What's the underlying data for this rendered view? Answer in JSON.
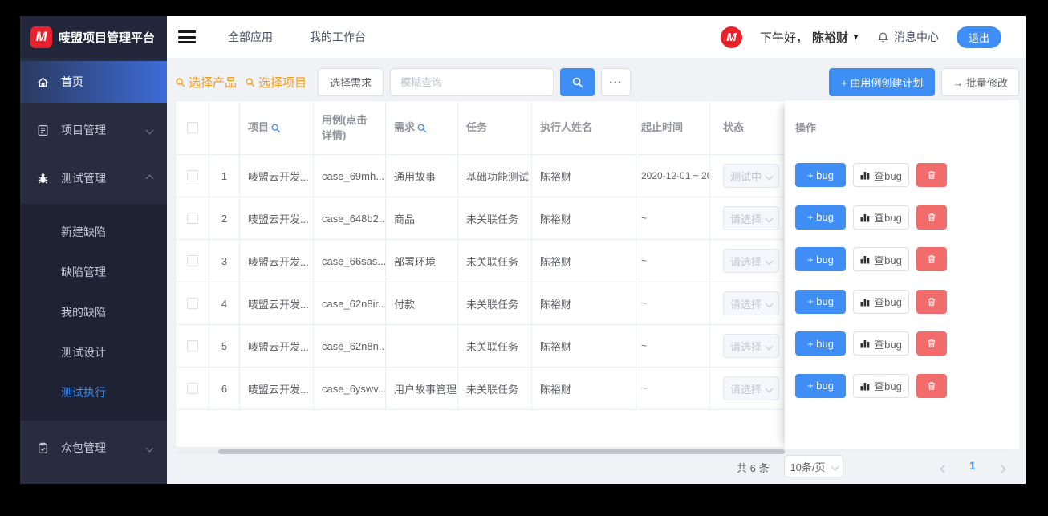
{
  "app": {
    "title": "唛盟项目管理平台",
    "logo_letter": "M"
  },
  "header": {
    "nav_all_apps": "全部应用",
    "nav_workbench": "我的工作台",
    "greeting": "下午好，",
    "username": "陈裕财",
    "message_center": "消息中心",
    "logout": "退出",
    "avatar_letter": "M"
  },
  "sidebar": {
    "home": "首页",
    "project_mgmt": "项目管理",
    "test_mgmt": "测试管理",
    "crowd_mgmt": "众包管理",
    "test_sub": [
      "新建缺陷",
      "缺陷管理",
      "我的缺陷",
      "测试设计",
      "测试执行"
    ]
  },
  "toolbar": {
    "select_product": "选择产品",
    "select_project": "选择项目",
    "select_requirement": "选择需求",
    "search_placeholder": "模糊查询",
    "more": "···",
    "create_plan": "+ 由用例创建计划",
    "batch_edit": "→ 批量修改"
  },
  "table": {
    "columns": {
      "project": "项目",
      "case": "用例(点击详情)",
      "requirement": "需求",
      "task": "任务",
      "executor": "执行人姓名",
      "time": "起止时间",
      "status": "状态",
      "ops": "操作"
    },
    "rows": [
      {
        "index": "1",
        "project": "唛盟云开发...",
        "case": "case_69mh...",
        "requirement": "通用故事",
        "task": "基础功能测试",
        "executor": "陈裕财",
        "time": "2020-12-01 ~ 20",
        "status": "测试中"
      },
      {
        "index": "2",
        "project": "唛盟云开发...",
        "case": "case_648b2...",
        "requirement": "商品",
        "task": "未关联任务",
        "executor": "陈裕财",
        "time": "~",
        "status": "请选择"
      },
      {
        "index": "3",
        "project": "唛盟云开发...",
        "case": "case_66sas...",
        "requirement": "部署环境",
        "task": "未关联任务",
        "executor": "陈裕财",
        "time": "~",
        "status": "请选择"
      },
      {
        "index": "4",
        "project": "唛盟云开发...",
        "case": "case_62n8ir...",
        "requirement": "付款",
        "task": "未关联任务",
        "executor": "陈裕财",
        "time": "~",
        "status": "请选择"
      },
      {
        "index": "5",
        "project": "唛盟云开发...",
        "case": "case_62n8n...",
        "requirement": "",
        "task": "未关联任务",
        "executor": "陈裕财",
        "time": "~",
        "status": "请选择"
      },
      {
        "index": "6",
        "project": "唛盟云开发...",
        "case": "case_6yswv...",
        "requirement": "用户故事管理",
        "task": "未关联任务",
        "executor": "陈裕财",
        "time": "~",
        "status": "请选择"
      }
    ]
  },
  "ops": {
    "add_bug": "+ bug",
    "view_bug": "查bug"
  },
  "footer": {
    "total": "共 6 条",
    "page_size": "10条/页",
    "current_page": "1"
  },
  "colors": {
    "primary": "#3e8ef5",
    "danger": "#f36c6c",
    "orange": "#f79b18",
    "sidebar_bg": "#282c3f",
    "logo_red": "#e8222d"
  }
}
